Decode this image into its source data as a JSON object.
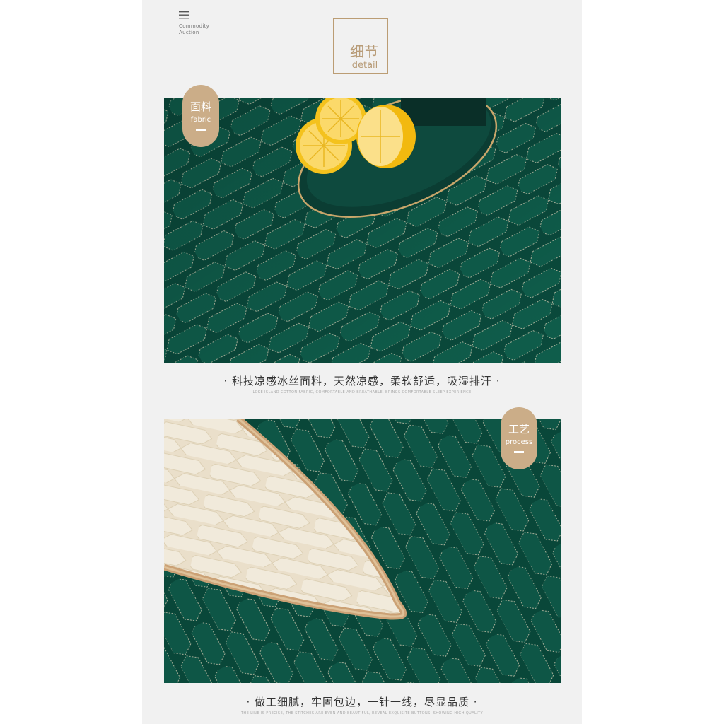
{
  "header": {
    "brand_line1": "Commodity",
    "brand_line2": "Auction",
    "title_cn": "细节",
    "title_en": "detail"
  },
  "section1": {
    "badge_cn": "面料",
    "badge_en": "fabric",
    "caption": "· 科技凉感冰丝面料，天然凉感，柔软舒适，吸湿排汗 ·",
    "subcaption": "LOKE ISLAND COTTON FABRIC, COMFORTABLE AND BREATHABLE, BRINGS COMFORTABLE SLEEP EXPERIENCE"
  },
  "section2": {
    "badge_cn": "工艺",
    "badge_en": "process",
    "caption": "· 做工细腻，牢固包边，一针一线，尽显品质 ·",
    "subcaption": "THE LINE IS PRECISE, THE STITCHES ARE EVEN AND BEAUTIFUL, REVEAL EXQUISITE BUTTONS, SHOWING HIGH QUALITY"
  },
  "colors": {
    "gold": "#cbad88",
    "fabric_green": "#0d5545",
    "cream": "#f4e9d3"
  },
  "icons": [
    "menu-icon"
  ]
}
